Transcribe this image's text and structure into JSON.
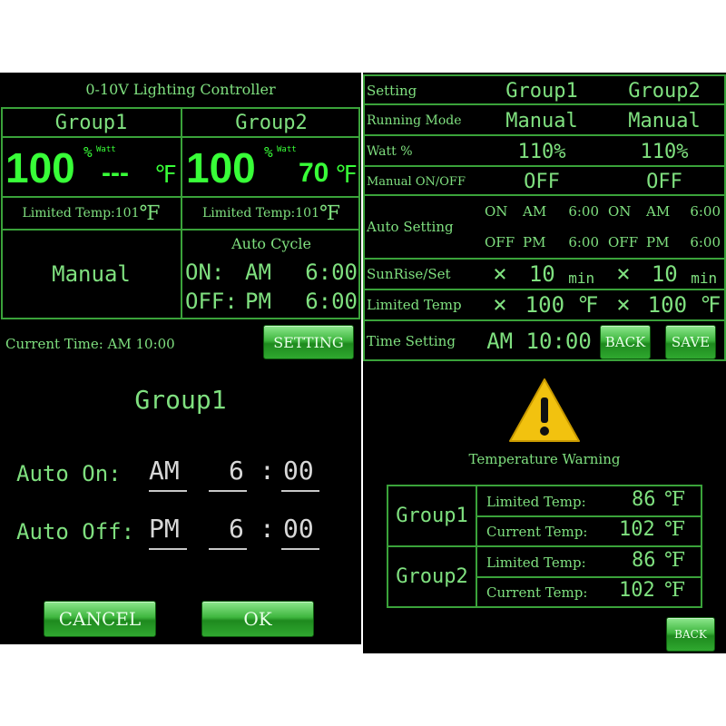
{
  "screen1": {
    "title": "0-10V Lighting Controller",
    "group1": {
      "name": "Group1",
      "percent": "100",
      "pct_sign": "%",
      "watt": "Watt",
      "temp": "---",
      "temp_unit": "℉",
      "limited": "Limited Temp:101",
      "limited_unit": "℉"
    },
    "group2": {
      "name": "Group2",
      "percent": "100",
      "pct_sign": "%",
      "watt": "Watt",
      "temp": "70",
      "temp_unit": "℉",
      "limited": "Limited Temp:101",
      "limited_unit": "℉"
    },
    "mode": "Manual",
    "auto": {
      "title": "Auto Cycle",
      "on_label": "ON:",
      "on_ampm": "AM",
      "on_time": "6:00",
      "off_label": "OFF:",
      "off_ampm": "PM",
      "off_time": "6:00"
    },
    "current_time": "Current Time: AM 10:00",
    "setting_button": "SETTING"
  },
  "screen2": {
    "headers": {
      "setting": "Setting",
      "group1": "Group1",
      "group2": "Group2"
    },
    "running_mode": {
      "label": "Running Mode",
      "g1": "Manual",
      "g2": "Manual"
    },
    "watt": {
      "label": "Watt %",
      "g1": "110%",
      "g2": "110%"
    },
    "manual": {
      "label": "Manual ON/OFF",
      "g1": "OFF",
      "g2": "OFF"
    },
    "auto": {
      "label": "Auto Setting",
      "g1_on": "ON",
      "g1_on_ampm": "AM",
      "g1_on_time": "6:00",
      "g1_off": "OFF",
      "g1_off_ampm": "PM",
      "g1_off_time": "6:00",
      "g2_on": "ON",
      "g2_on_ampm": "AM",
      "g2_on_time": "6:00",
      "g2_off": "OFF",
      "g2_off_ampm": "PM",
      "g2_off_time": "6:00"
    },
    "sunrise": {
      "label": "SunRise/Set",
      "x": "×",
      "g1_val": "10",
      "g2_val": "10",
      "unit": "min"
    },
    "limited": {
      "label": "Limited Temp",
      "x": "×",
      "g1_val": "100",
      "g2_val": "100",
      "unit": "℉"
    },
    "time": {
      "label": "Time Setting",
      "ampm": "AM",
      "value": "10:00"
    },
    "back_button": "BACK",
    "save_button": "SAVE"
  },
  "screen3": {
    "title": "Group1",
    "on_label": "Auto On:",
    "on_ampm": "AM",
    "on_hour": "6",
    "on_colon": ":",
    "on_min": "00",
    "off_label": "Auto Off:",
    "off_ampm": "PM",
    "off_hour": "6",
    "off_colon": ":",
    "off_min": "00",
    "cancel_button": "CANCEL",
    "ok_button": "OK"
  },
  "screen4": {
    "warning_title": "Temperature Warning",
    "rows": [
      {
        "group": "Group1",
        "limited_label": "Limited Temp:",
        "limited_val": "86",
        "current_label": "Current Temp:",
        "current_val": "102",
        "unit": "℉"
      },
      {
        "group": "Group2",
        "limited_label": "Limited Temp:",
        "limited_val": "86",
        "current_label": "Current Temp:",
        "current_val": "102",
        "unit": "℉"
      }
    ],
    "back_button": "BACK"
  },
  "colors": {
    "accent": "#38ff38",
    "text": "#7fe07f",
    "border": "#3aa23a",
    "warning": "#f2c20f"
  }
}
